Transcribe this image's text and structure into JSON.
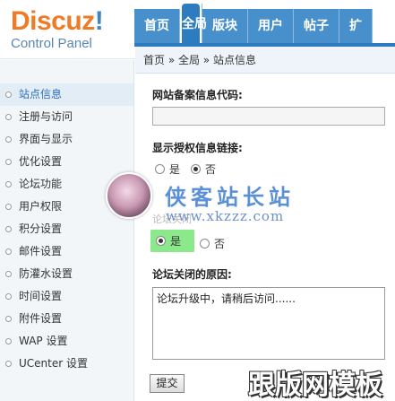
{
  "logo": {
    "brand": "Discuz",
    "excl": "!",
    "subtitle": "Control Panel"
  },
  "topnav": [
    "首页",
    "全局",
    "版块",
    "用户",
    "帖子",
    "扩"
  ],
  "topnav_active": "全局",
  "breadcrumb": "首页 » 全局 » 站点信息",
  "sidebar": {
    "items": [
      "站点信息",
      "注册与访问",
      "界面与显示",
      "优化设置",
      "论坛功能",
      "用户权限",
      "积分设置",
      "邮件设置",
      "防灌水设置",
      "时间设置",
      "附件设置",
      "WAP 设置",
      "UCenter 设置"
    ],
    "active_index": 0
  },
  "form": {
    "beian_label": "网站备案信息代码:",
    "beian_value": "",
    "license_label": "显示授权信息链接:",
    "license_yes": "是",
    "license_no": "否",
    "license_selected": "否",
    "close_label": "论坛关闭",
    "close_yes": "是",
    "close_no": "否",
    "close_selected": "是",
    "reason_label": "论坛关闭的原因:",
    "reason_value": "论坛升级中，请稍后访问......",
    "submit": "提交"
  },
  "watermark": {
    "title": "侠客站长站",
    "url": "www.xkzzz.com",
    "bottom": "跟版网模板"
  },
  "colors": {
    "accent": "#2d7cbf",
    "tab": "#4890cb",
    "logo_orange": "#f07b26",
    "highlight_green": "#8be88b"
  }
}
